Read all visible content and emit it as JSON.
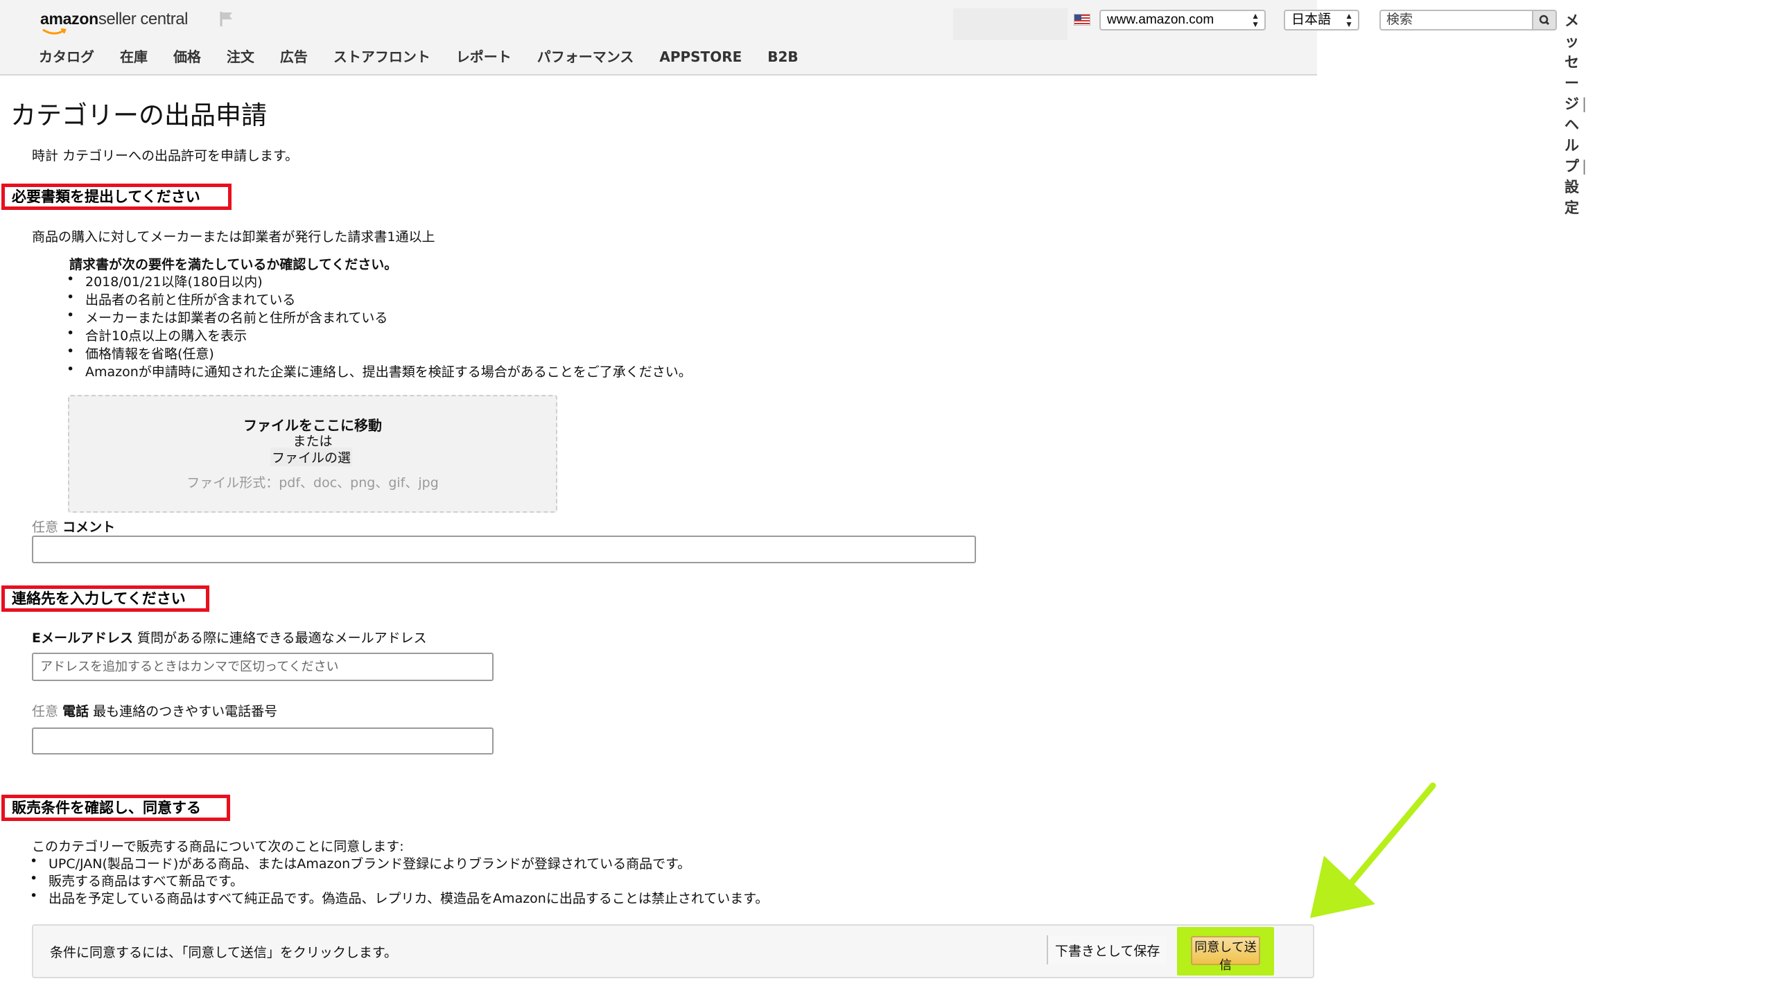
{
  "header": {
    "logo_amazon": "amazon",
    "logo_seller": "seller central",
    "marketplace_value": "www.amazon.com",
    "language_value": "日本語",
    "search_placeholder": "検索",
    "links": [
      "メッセージ",
      "ヘルプ",
      "設定"
    ],
    "nav": [
      "カタログ",
      "在庫",
      "価格",
      "注文",
      "広告",
      "ストアフロント",
      "レポート",
      "パフォーマンス",
      "APPSTORE",
      "B2B"
    ]
  },
  "page": {
    "title": "カテゴリーの出品申請",
    "subtitle": "時計 カテゴリーへの出品許可を申請します。"
  },
  "documents": {
    "section_title": "必要書類を提出してください",
    "intro": "商品の購入に対してメーカーまたは卸業者が発行した請求書1通以上",
    "requirements_heading": "請求書が次の要件を満たしているか確認してください。",
    "requirements": [
      "2018/01/21以降(180日以内)",
      "出品者の名前と住所が含まれている",
      "メーカーまたは卸業者の名前と住所が含まれている",
      "合計10点以上の購入を表示",
      "価格情報を省略(任意)",
      "Amazonが申請時に通知された企業に連絡し、提出書類を検証する場合があることをご了承ください。"
    ],
    "dropzone": {
      "title": "ファイルをここに移動",
      "or": "または",
      "choose_file": "ファイルの選",
      "formats": "ファイル形式：pdf、doc、png、gif、jpg"
    },
    "comment_optional": "任意",
    "comment_label": "コメント",
    "comment_value": ""
  },
  "contact": {
    "section_title": "連絡先を入力してください",
    "email_label": "Eメールアドレス",
    "email_hint": "質問がある際に連絡できる最適なメールアドレス",
    "email_placeholder": "アドレスを追加するときはカンマで区切ってください",
    "phone_optional": "任意",
    "phone_label": "電話",
    "phone_hint": "最も連絡のつきやすい電話番号",
    "phone_value": ""
  },
  "terms": {
    "section_title": "販売条件を確認し、同意する",
    "intro": "このカテゴリーで販売する商品について次のことに同意します:",
    "items": [
      "UPC/JAN(製品コード)がある商品、またはAmazonブランド登録によりブランドが登録されている商品です。",
      "販売する商品はすべて新品です。",
      "出品を予定している商品はすべて純正品です。偽造品、レプリカ、模造品をAmazonに出品することは禁止されています。"
    ],
    "agree_instruction": "条件に同意するには、「同意して送信」をクリックします。",
    "save_draft_label": "下書きとして保存",
    "agree_submit_label": "同意して送信"
  },
  "colors": {
    "section_border": "#e8101e",
    "highlight": "#b6ef19",
    "button_gold": "#f0c14b",
    "amazon_orange": "#ff9900"
  }
}
